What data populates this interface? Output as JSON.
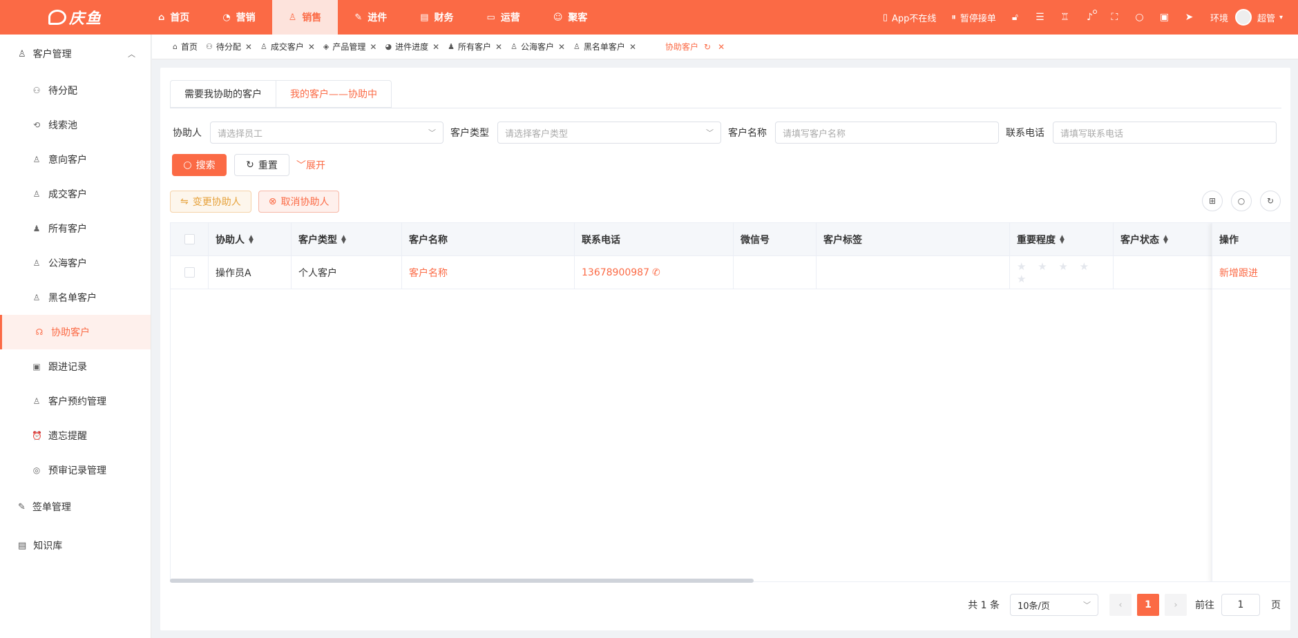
{
  "brand": {
    "name": "庆鱼"
  },
  "topnav": [
    {
      "label": "首页",
      "icon": "home-icon",
      "glyph": "⌂"
    },
    {
      "label": "营销",
      "icon": "chart-icon",
      "glyph": "◔"
    },
    {
      "label": "销售",
      "icon": "user-icon",
      "glyph": "♙"
    },
    {
      "label": "进件",
      "icon": "edit-icon",
      "glyph": "✎"
    },
    {
      "label": "财务",
      "icon": "finance-icon",
      "glyph": "▤"
    },
    {
      "label": "运营",
      "icon": "monitor-icon",
      "glyph": "▭"
    },
    {
      "label": "聚客",
      "icon": "group-icon",
      "glyph": "☺"
    }
  ],
  "topright": {
    "app_status": "App不在线",
    "pause": "暂停接单",
    "env": "环境",
    "user": "超管"
  },
  "sidebar": {
    "group1": "客户管理",
    "items": [
      {
        "label": "待分配",
        "glyph": "⚇"
      },
      {
        "label": "线索池",
        "glyph": "⟲"
      },
      {
        "label": "意向客户",
        "glyph": "♙"
      },
      {
        "label": "成交客户",
        "glyph": "♙"
      },
      {
        "label": "所有客户",
        "glyph": "♟"
      },
      {
        "label": "公海客户",
        "glyph": "♙"
      },
      {
        "label": "黑名单客户",
        "glyph": "♙"
      },
      {
        "label": "协助客户",
        "glyph": "☊"
      },
      {
        "label": "跟进记录",
        "glyph": "▣"
      },
      {
        "label": "客户预约管理",
        "glyph": "♙"
      },
      {
        "label": "遗忘提醒",
        "glyph": "⏰"
      },
      {
        "label": "预审记录管理",
        "glyph": "◎"
      }
    ],
    "group2": "签单管理",
    "group3": "知识库"
  },
  "tabs": [
    {
      "label": "首页",
      "glyph": "⌂"
    },
    {
      "label": "待分配",
      "glyph": "⚇"
    },
    {
      "label": "成交客户",
      "glyph": "♙"
    },
    {
      "label": "产品管理",
      "glyph": "◈"
    },
    {
      "label": "进件进度",
      "glyph": "◕"
    },
    {
      "label": "所有客户",
      "glyph": "♟"
    },
    {
      "label": "公海客户",
      "glyph": "♙"
    },
    {
      "label": "黑名单客户",
      "glyph": "♙"
    },
    {
      "label": "协助客户",
      "glyph": ""
    }
  ],
  "subtabs": {
    "first": "需要我协助的客户",
    "second": "我的客户——协助中"
  },
  "filters": {
    "assistant_label": "协助人",
    "assistant_ph": "请选择员工",
    "type_label": "客户类型",
    "type_ph": "请选择客户类型",
    "name_label": "客户名称",
    "name_ph": "请填写客户名称",
    "phone_label": "联系电话",
    "phone_ph": "请填写联系电话"
  },
  "buttons": {
    "search": "搜索",
    "reset": "重置",
    "expand": "展开",
    "change": "变更协助人",
    "cancel": "取消协助人"
  },
  "table": {
    "headers": [
      "协助人",
      "客户类型",
      "客户名称",
      "联系电话",
      "微信号",
      "客户标签",
      "重要程度",
      "客户状态",
      "操作"
    ],
    "rows": [
      {
        "assistant": "操作员A",
        "type": "个人客户",
        "name": "客户名称",
        "phone": "13678900987",
        "wechat": "",
        "tags": "",
        "stars": "★ ★ ★ ★ ★",
        "status": "",
        "action": "新增跟进"
      }
    ]
  },
  "pager": {
    "total": "共 1 条",
    "size": "10条/页",
    "page": "1",
    "goto": "前往",
    "goto_val": "1",
    "unit": "页"
  },
  "colors": {
    "accent": "#fb6a45",
    "warn": "#e6a23c"
  }
}
